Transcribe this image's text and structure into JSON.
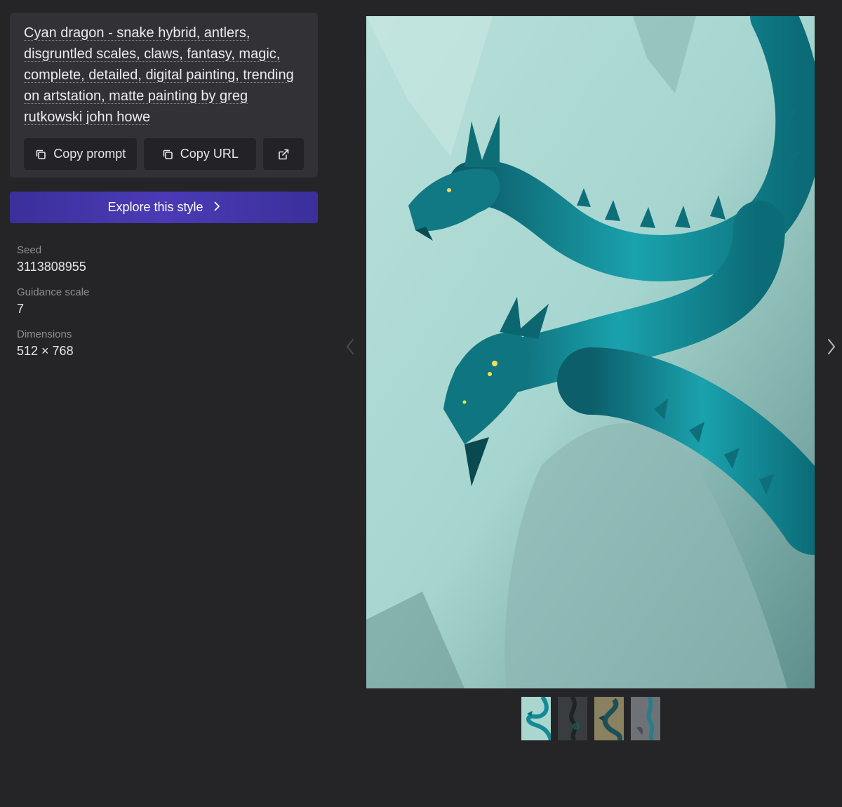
{
  "prompt": {
    "text": "Cyan dragon - snake hybrid, antlers, disgruntled scales, claws, fantasy, magic, complete, detailed, digital painting, trending on artstation, matte painting by greg rutkowski john howe"
  },
  "actions": {
    "copy_prompt_label": "Copy prompt",
    "copy_url_label": "Copy URL",
    "copy_icon": "copy-icon",
    "external_icon": "external-link-icon"
  },
  "explore": {
    "label": "Explore this style",
    "icon": "chevron-right-icon",
    "accent": "#4a3bb5"
  },
  "meta": {
    "seed_label": "Seed",
    "seed_value": "3113808955",
    "guidance_label": "Guidance scale",
    "guidance_value": "7",
    "dimensions_label": "Dimensions",
    "dimensions_value": "512 × 768"
  },
  "navigation": {
    "prev_icon": "chevron-left-icon",
    "next_icon": "chevron-right-icon"
  },
  "image": {
    "description_icon": "generated-image",
    "selected_thumbnail": 1,
    "thumbnail_count": 4
  },
  "colors": {
    "background": "#252528",
    "card": "#313136",
    "button": "#232327",
    "dragon": "#138a96"
  }
}
